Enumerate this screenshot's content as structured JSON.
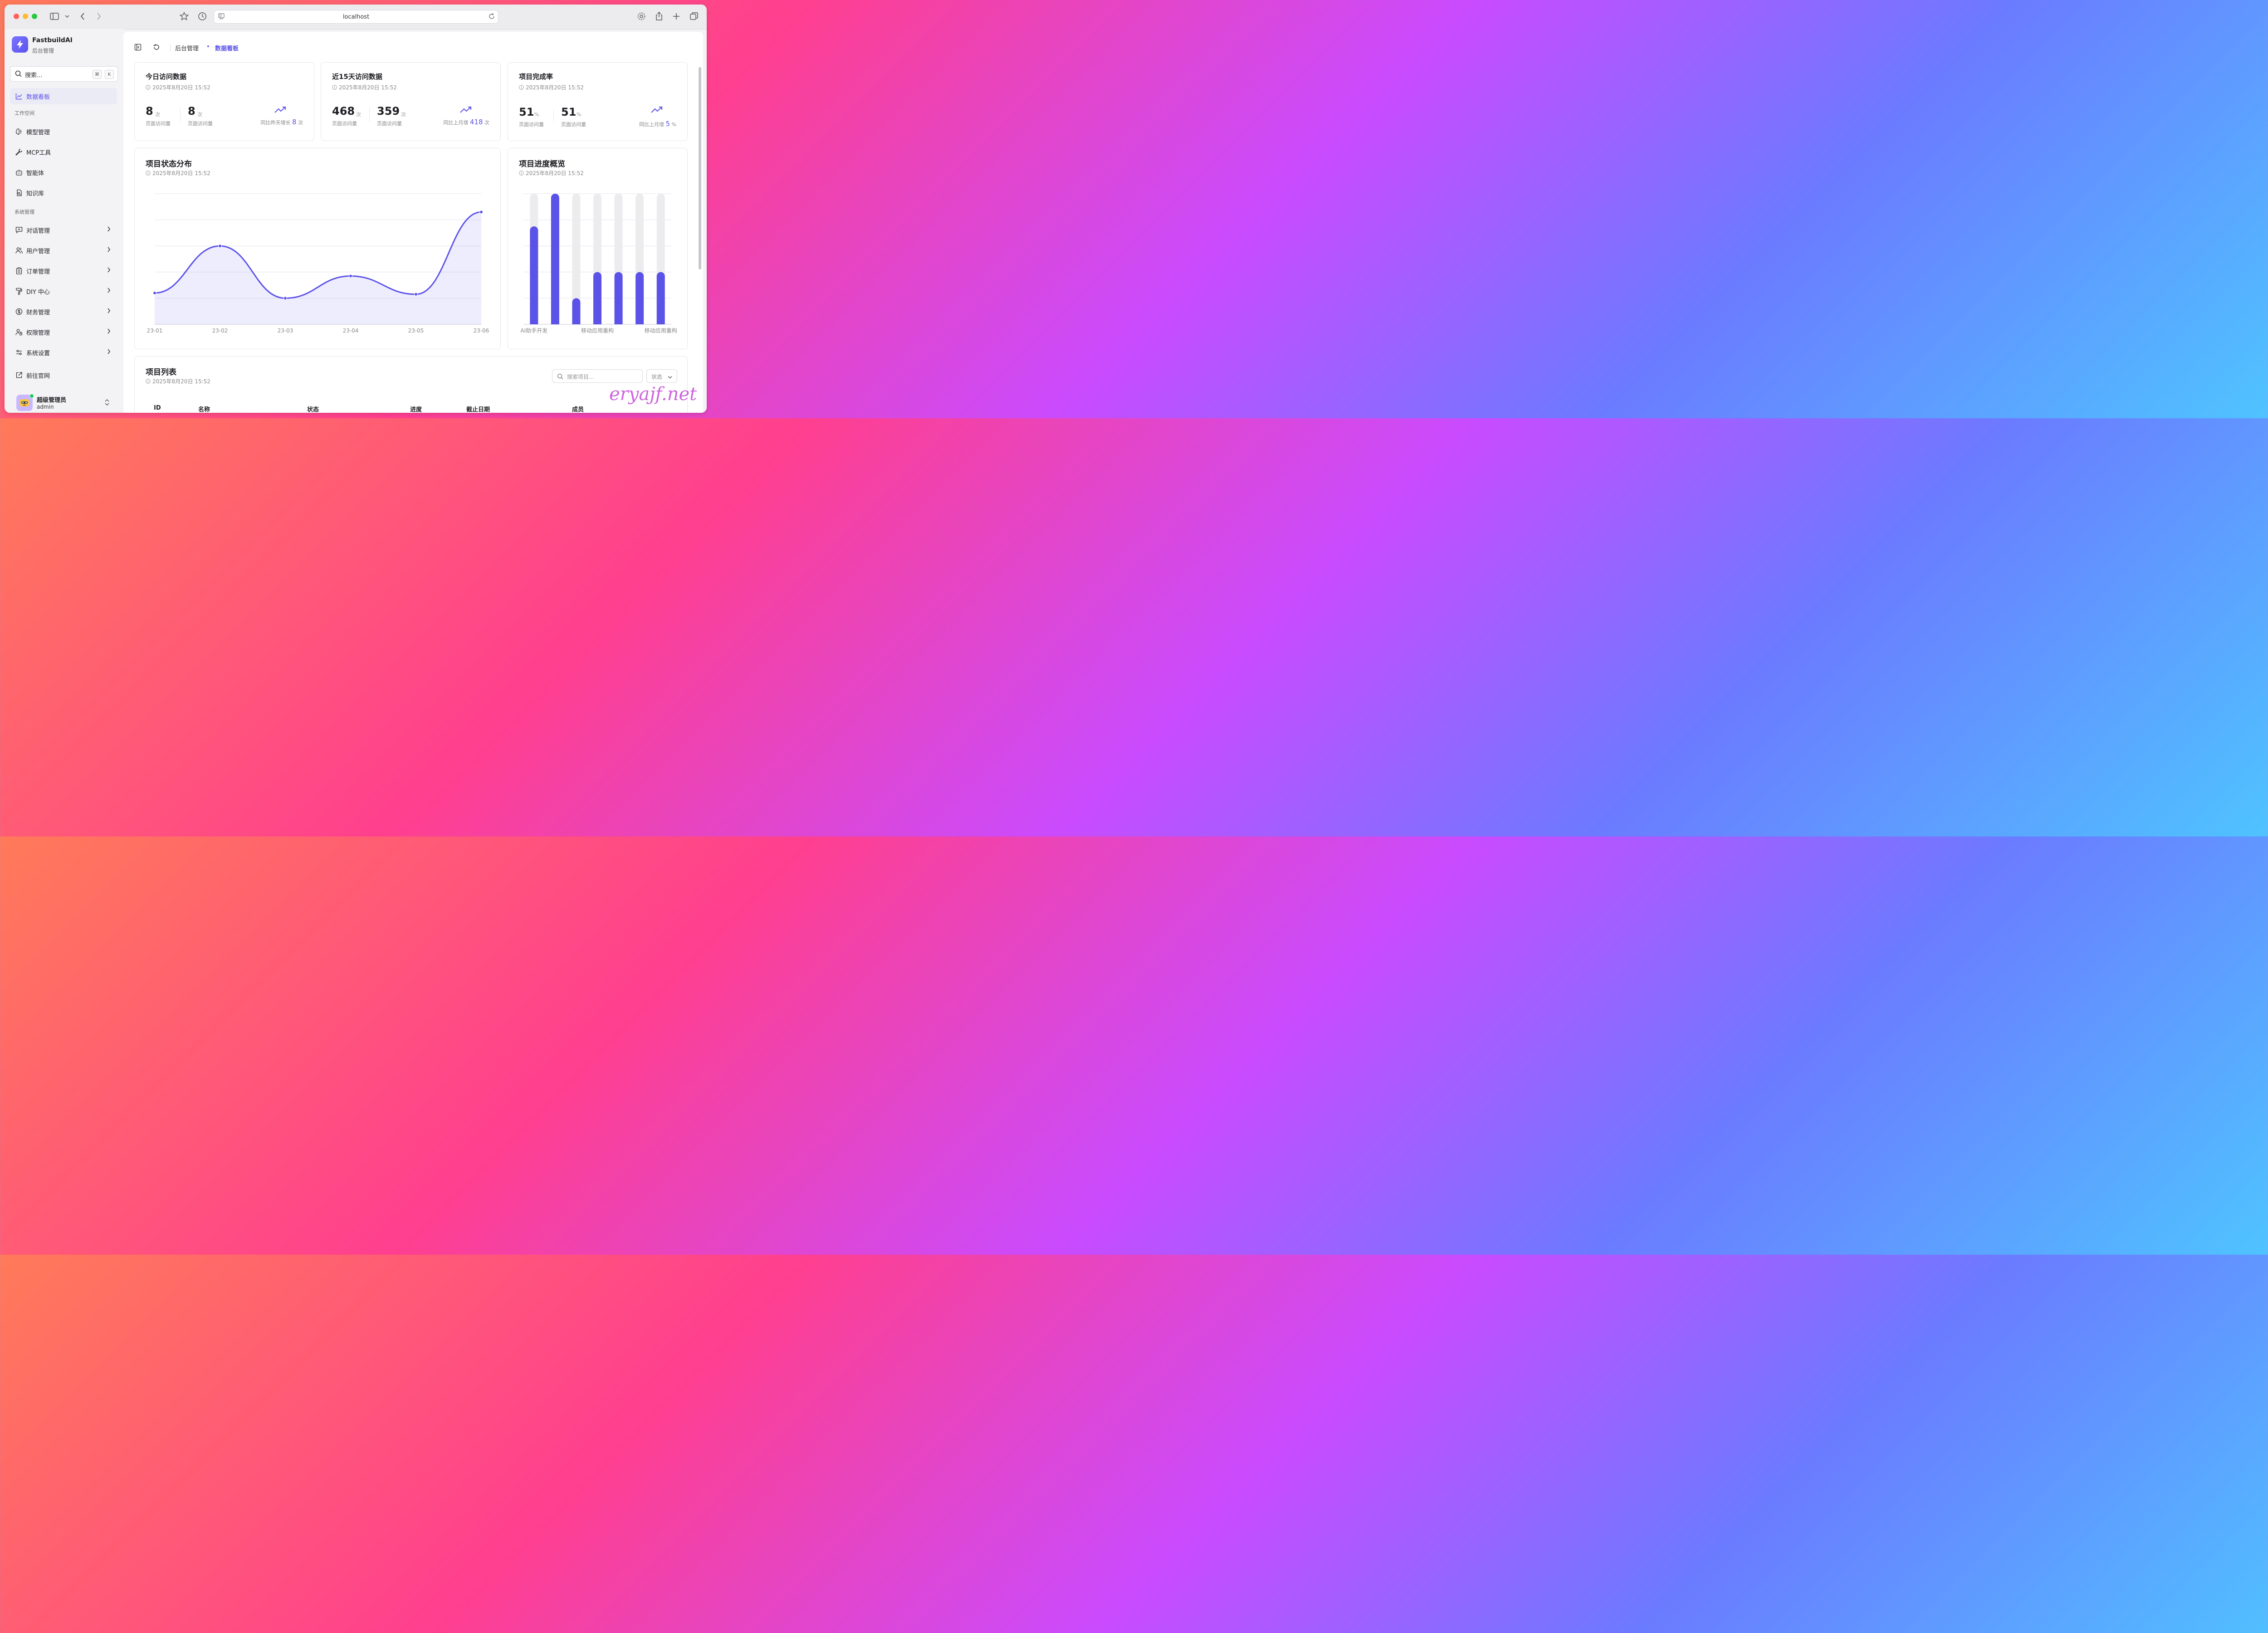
{
  "browser": {
    "url": "localhost"
  },
  "sidebar": {
    "brand_name": "FastbuildAI",
    "brand_sub": "后台管理",
    "search_placeholder": "搜索...",
    "search_kbd1": "⌘",
    "search_kbd2": "K",
    "dashboard": "数据看板",
    "workspace_label": "工作空间",
    "workspace_items": [
      "模型管理",
      "MCP工具",
      "智能体",
      "知识库"
    ],
    "system_label": "系统管理",
    "system_items": [
      "对话管理",
      "用户管理",
      "订单管理",
      "DIY 中心",
      "财务管理",
      "权限管理",
      "系统设置"
    ],
    "official_site": "前往官网",
    "user": {
      "name": "超级管理员",
      "role": "admin"
    }
  },
  "breadcrumb": {
    "parent": "后台管理",
    "separator": "•",
    "current": "数据看板"
  },
  "accent_color": "#5b52e8",
  "stats": {
    "today": {
      "title": "今日访问数据",
      "time": "2025年8月20日 15:52",
      "v1": "8",
      "u1": "次",
      "l1": "页面访问量",
      "v2": "8",
      "u2": "次",
      "l2": "页面访问量",
      "compare_prefix": "同比昨天增长",
      "compare_value": "8",
      "compare_unit": "次"
    },
    "days15": {
      "title": "近15天访问数据",
      "time": "2025年8月20日 15:52",
      "v1": "468",
      "u1": "次",
      "l1": "页面访问量",
      "v2": "359",
      "u2": "次",
      "l2": "页面访问量",
      "compare_prefix": "同比上月增",
      "compare_value": "418",
      "compare_unit": "次"
    },
    "completion": {
      "title": "项目完成率",
      "time": "2025年8月20日 15:52",
      "v1": "51",
      "u1": "%",
      "l1": "页面访问量",
      "v2": "51",
      "u2": "%",
      "l2": "页面访问量",
      "compare_prefix": "同比上月增",
      "compare_value": "5",
      "compare_unit": "%"
    }
  },
  "status_chart": {
    "title": "项目状态分布",
    "time": "2025年8月20日 15:52",
    "x_labels": [
      "23-01",
      "23-02",
      "23-03",
      "23-04",
      "23-05",
      "23-06"
    ]
  },
  "progress_chart": {
    "title": "项目进度概览",
    "time": "2025年8月20日 15:52",
    "x_labels": [
      "AI助手开发",
      "移动应用重构",
      "移动应用重构"
    ]
  },
  "chart_data": [
    {
      "type": "area",
      "categories": [
        "23-01",
        "23-02",
        "23-03",
        "23-04",
        "23-05",
        "23-06"
      ],
      "values": [
        12,
        30,
        10,
        18.5,
        11.5,
        43
      ],
      "ylim": [
        0,
        50
      ],
      "grid": true,
      "color": "#5b52e8"
    },
    {
      "type": "bar",
      "categories": [
        "AI助手开发",
        "",
        "",
        "移动应用重构",
        "",
        "",
        "移动应用重构"
      ],
      "values": [
        75,
        100,
        20,
        40,
        40,
        40,
        40
      ],
      "ylim": [
        0,
        100
      ],
      "grid": true,
      "color": "#5b52e8"
    }
  ],
  "project_list": {
    "title": "项目列表",
    "time": "2025年8月20日 15:52",
    "search_placeholder": "搜索项目...",
    "status_label": "状态",
    "columns": [
      "ID",
      "名称",
      "状态",
      "进度",
      "截止日期",
      "成员"
    ]
  },
  "watermark": "eryajf.net"
}
